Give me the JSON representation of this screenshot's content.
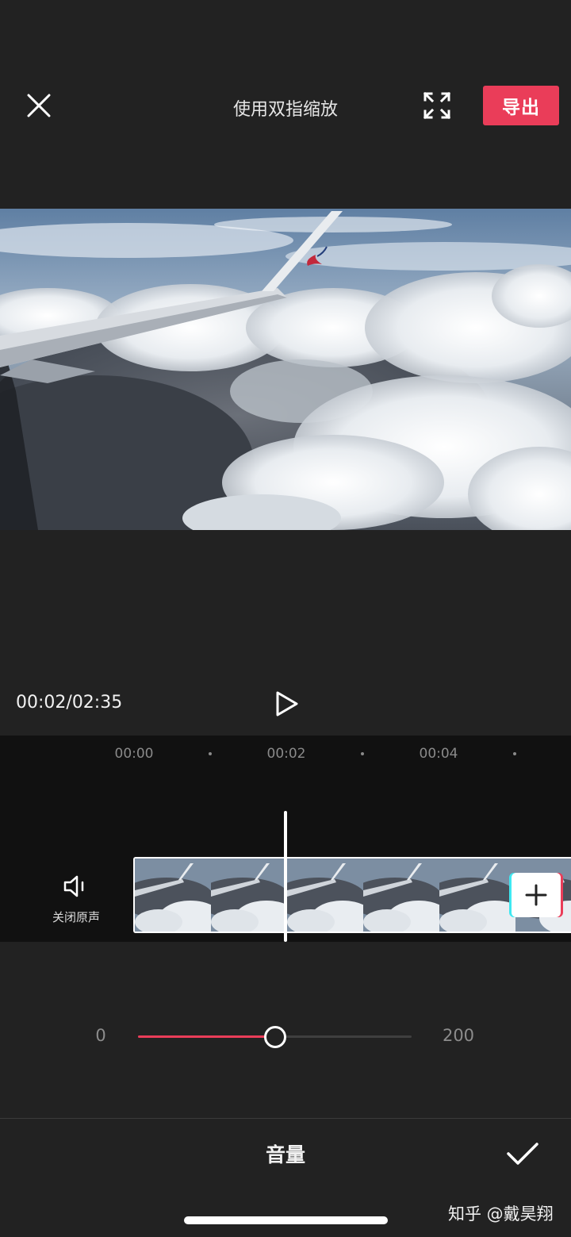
{
  "top_bar": {
    "title": "使用双指缩放",
    "export_label": "导出",
    "close_icon": "close-icon",
    "fullscreen_icon": "fullscreen-icon"
  },
  "preview": {
    "description_icon": "video-preview"
  },
  "playback": {
    "time_readout": "00:02/02:35",
    "play_icon": "play-icon"
  },
  "timeline": {
    "ticks": [
      "00:00",
      "00:02",
      "00:04"
    ],
    "mute_label": "关闭原声",
    "mute_icon": "speaker-icon",
    "add_icon": "plus-icon"
  },
  "volume": {
    "min_label": "0",
    "max_label": "200",
    "value": 100,
    "min": 0,
    "max": 200,
    "accent": "#ea3d59"
  },
  "bottom_bar": {
    "panel_title": "音量",
    "confirm_icon": "check-icon"
  },
  "watermark": "知乎 @戴昊翔",
  "colors": {
    "background": "#222222",
    "accent": "#ea3d59",
    "timeline_bg": "#111111"
  }
}
